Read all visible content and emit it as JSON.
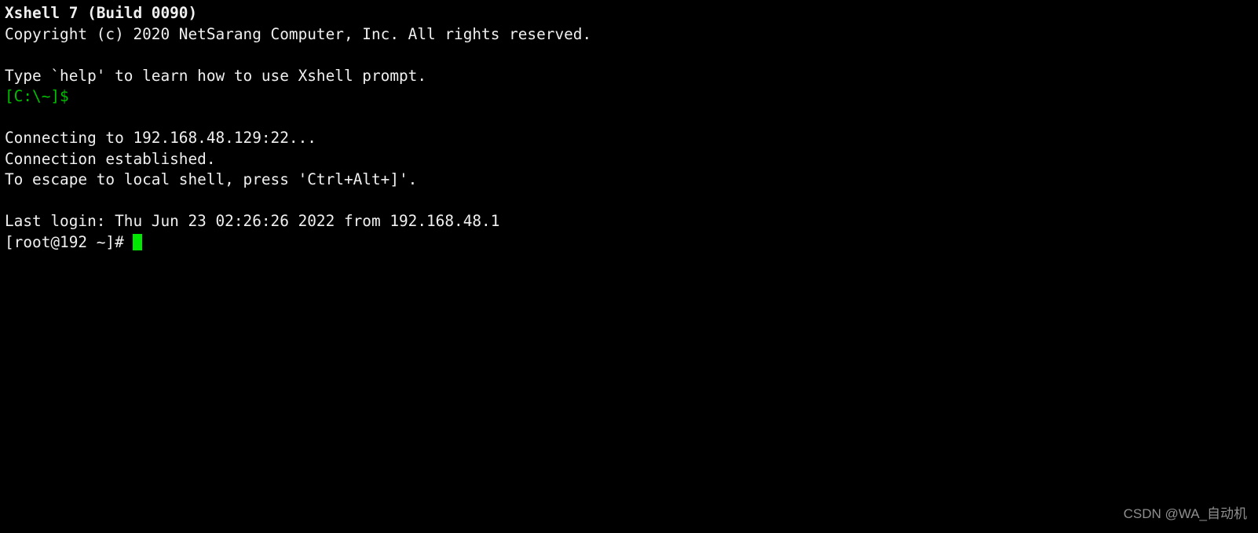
{
  "terminal": {
    "background_color": "#000000",
    "foreground_color": "#f0f0f0",
    "prompt_color": "#00c000",
    "cursor_color": "#00e800",
    "lines": [
      {
        "text": "Xshell 7 (Build 0090)",
        "style": "bold"
      },
      {
        "text": "Copyright (c) 2020 NetSarang Computer, Inc. All rights reserved.",
        "style": "normal"
      },
      {
        "text": "",
        "style": "blank"
      },
      {
        "text": "Type `help' to learn how to use Xshell prompt.",
        "style": "normal"
      },
      {
        "text": "[C:\\~]$",
        "style": "green"
      },
      {
        "text": "",
        "style": "blank"
      },
      {
        "text": "Connecting to 192.168.48.129:22...",
        "style": "normal"
      },
      {
        "text": "Connection established.",
        "style": "normal"
      },
      {
        "text": "To escape to local shell, press 'Ctrl+Alt+]'.",
        "style": "normal"
      },
      {
        "text": "",
        "style": "blank"
      },
      {
        "text": "Last login: Thu Jun 23 02:26:26 2022 from 192.168.48.1",
        "style": "normal"
      }
    ],
    "active_prompt": {
      "text": "[root@192 ~]# ",
      "cursor_visible": true
    }
  },
  "watermark": {
    "text": "CSDN @WA_自动机",
    "color": "#8e8e8e"
  }
}
